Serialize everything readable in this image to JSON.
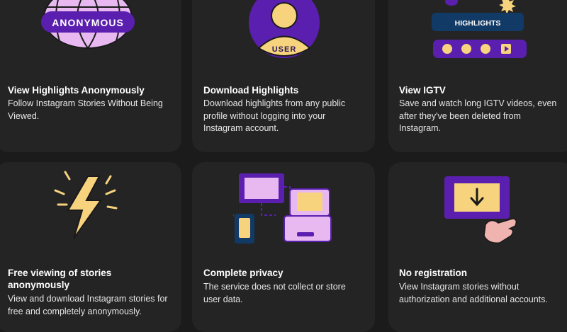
{
  "features": [
    {
      "id": "anonymous",
      "title": "View Highlights Anonymously",
      "desc": "Follow Instagram Stories Without Being Viewed.",
      "badge": "ANONYMOUS"
    },
    {
      "id": "download",
      "title": "Download Highlights",
      "desc": "Download highlights from any public profile without logging into your Instagram account.",
      "badge": "USER"
    },
    {
      "id": "igtv",
      "title": "View IGTV",
      "desc": "Save and watch long IGTV videos, even after they've been deleted from Instagram.",
      "badge": "HIGHLIGHTS"
    },
    {
      "id": "free",
      "title": "Free viewing of stories anonymously",
      "desc": "View and download Instagram stories for free and completely anonymously."
    },
    {
      "id": "privacy",
      "title": "Complete privacy",
      "desc": "The service does not collect or store user data."
    },
    {
      "id": "registration",
      "title": "No registration",
      "desc": "View Instagram stories without authorization and additional accounts."
    }
  ],
  "colors": {
    "background": "#1b1b1c",
    "card": "#242425",
    "purple": "#5b1fb0",
    "lilac": "#e8b9f0",
    "yellow": "#f7d37d",
    "navy": "#123a66"
  },
  "icons": [
    "globe-icon",
    "user-icon",
    "highlights-icon",
    "lightning-icon",
    "devices-icon",
    "download-icon"
  ]
}
